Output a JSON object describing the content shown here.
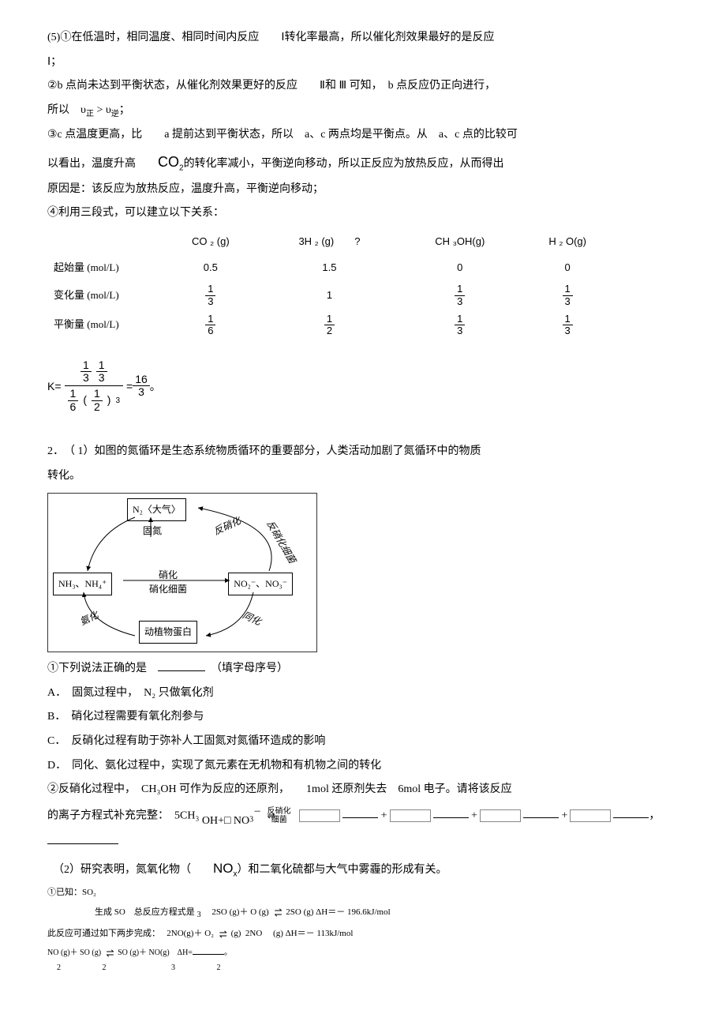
{
  "p5_1": "(5)①在低温时，相同温度、相同时间内反应　　Ⅰ转化率最高，所以催化剂效果最好的是反应",
  "p5_1b": "Ⅰ；",
  "p5_2a": "②b 点尚未达到平衡状态，从催化剂效果更好的反应　　Ⅱ和 Ⅲ 可知，　b 点反应仍正向进行，",
  "p5_2b_pre": "所以　υ",
  "p5_2b_zheng": "正",
  "p5_2b_mid": " > υ",
  "p5_2b_ni": "逆",
  "p5_2b_post": "；",
  "p5_3a": "③c 点温度更高，比　　a 提前达到平衡状态，所以　a、c 两点均是平衡点。从　a、c 点的比较可",
  "p5_3b_pre": "以看出，温度升高　　",
  "p5_3b_co2": "CO",
  "p5_3b_post": "的转化率减小，平衡逆向移动，所以正反应为放热反应，从而得出",
  "p5_3c": "原因是：该反应为放热反应，温度升高，平衡逆向移动；",
  "p5_4": "④利用三段式，可以建立以下关系：",
  "table": {
    "headers": [
      "",
      "CO ₂ (g)",
      "3H ₂ (g)　　?",
      "CH ₃OH(g)",
      "H ₂ O(g)"
    ],
    "row1_label": "起始量 (mol/L)",
    "row1": [
      "0.5",
      "1.5",
      "0",
      "0"
    ],
    "row2_label": "变化量  (mol/L)",
    "row2_fracs": [
      [
        "1",
        "3"
      ],
      null,
      [
        "1",
        "3"
      ],
      [
        "1",
        "3"
      ]
    ],
    "row2_plain": [
      null,
      "1",
      null,
      null
    ],
    "row3_label": "平衡量 (mol/L)",
    "row3_fracs": [
      [
        "1",
        "6"
      ],
      [
        "1",
        "2"
      ],
      [
        "1",
        "3"
      ],
      [
        "1",
        "3"
      ]
    ]
  },
  "k_eq": {
    "prefix": "K=",
    "top": [
      [
        "1",
        "3"
      ],
      [
        "1",
        "3"
      ]
    ],
    "bot": [
      [
        "1",
        "6"
      ],
      [
        "1",
        "2"
      ]
    ],
    "bot_exp": "3",
    "equals": " = ",
    "result": [
      "16",
      "3"
    ],
    "suffix": "。"
  },
  "q2_intro_a": "2．　（ 1）如图的氮循环是生态系统物质循环的重要部分，人类活动加剧了氮循环中的物质",
  "q2_intro_b": "转化。",
  "diagram": {
    "n2": "N₂〈大气〉",
    "nh3": "NH₃、NH₄⁺",
    "no": "NO₂⁻、NO₃⁻",
    "protein": "动植物蛋白",
    "gudan": "固氮",
    "fanxiaohua": "反硝化",
    "fxh_bac": "反硝化细菌",
    "xiaohua": "硝化",
    "xh_bac": "硝化细菌",
    "tonghua": "同化",
    "anhua": "氨化"
  },
  "q2_1_pre": "①下列说法正确的是　",
  "q2_1_post": "　（填字母序号）",
  "q2_A": "A．　固氮过程中，　N₂ 只做氧化剂",
  "q2_B": "B．　硝化过程需要有氧化剂参与",
  "q2_C": "C．　反硝化过程有助于弥补人工固氮对氮循环造成的影响",
  "q2_D": "D．　同化、氨化过程中，实现了氮元素在无机物和有机物之间的转化",
  "q2_2a": "②反硝化过程中，　CH₃OH 可作为反应的还原剂，　　1mol 还原剂失去　6mol 电子。请将该反应",
  "q2_2b_pre": "的离子方程式补充完整：　5CH₃",
  "q2_2b_oh": "OH+□ NO",
  "q2_2b_sub": "3",
  "q2_2b_arrow_top": "反硝化",
  "q2_2b_arrow_bot": "细菌",
  "q2_part2_pre": "　（2）研究表明，氮氧化物（　　",
  "q2_part2_no": "NO",
  "q2_part2_sub": "x",
  "q2_part2_post": "）和二氧化硫都与大气中雾霾的形成有关。",
  "q2_eq1_pre": "①已知：SO₂",
  "q2_eq1_line2a": "生成 SO　总反应方程式是",
  "q2_eq1_line2b": "2SO  (g)＋ O  (g)",
  "q2_eq1_line2c": "2SO (g) ΔH＝－ 196.6kJ/mol",
  "q2_eq1_subline": "3",
  "q2_eq2_pre": "此反应可通过如下两步完成：",
  "q2_eq2a": "2NO(g)＋ O₂",
  "q2_eq2b": "(g)",
  "q2_eq2c": "2NO　 (g) ΔH＝－ 113kJ/mol",
  "q2_eq3_pre": "NO (g)＋ SO (g)",
  "q2_eq3_mid": "SO (g)＋ NO(g)　ΔH=",
  "q2_eq3_subA": "2",
  "q2_eq3_subB": "2",
  "q2_eq3_subC": "3",
  "q2_eq3_subD": "2",
  "q2_eq3_post": "。"
}
